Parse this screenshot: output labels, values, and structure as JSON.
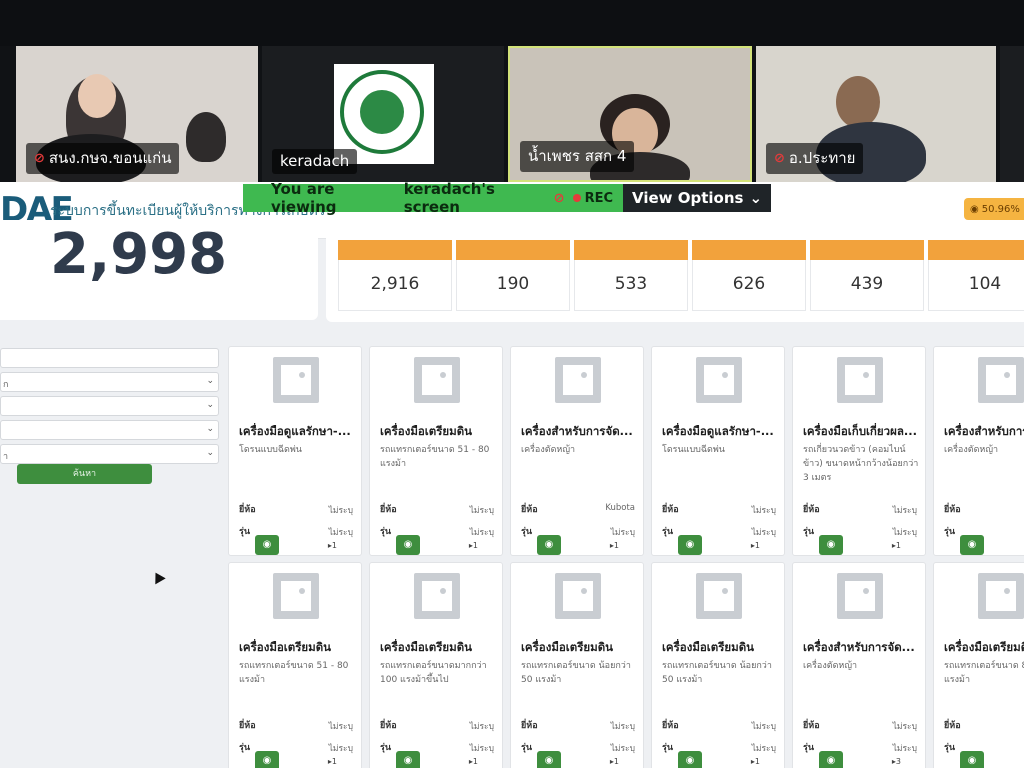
{
  "participants": [
    {
      "name": "สนง.กษจ.ขอนแก่น",
      "muted": true
    },
    {
      "name": "keradach",
      "muted": false
    },
    {
      "name": "น้ำเพชร สสก 4",
      "muted": false
    },
    {
      "name": "อ.ประทาย",
      "muted": true
    }
  ],
  "banner": {
    "viewing": "You are viewing",
    "sharer": "keradach's screen",
    "rec": "REC",
    "view_options": "View Options"
  },
  "site": {
    "logo": "DAE",
    "title": "ระบบการขึ้นทะเบียนผู้ให้บริการทางการเกษตร",
    "badge": "50.96%",
    "total": "2,998",
    "stats": [
      "2,916",
      "190",
      "533",
      "626",
      "439",
      "104"
    ],
    "search_button": "ค้นหา"
  },
  "cards_row1": [
    {
      "name": "เครื่องมือดูแลรักษา-...",
      "desc": "โดรนแบบฉีดพ่น",
      "brand": "ไม่ระบุ",
      "model": "ไม่ระบุ",
      "count": "1"
    },
    {
      "name": "เครื่องมือเตรียมดิน",
      "desc": "รถแทรกเตอร์ขนาด 51 - 80 แรงม้า",
      "brand": "ไม่ระบุ",
      "model": "ไม่ระบุ",
      "count": "1"
    },
    {
      "name": "เครื่องสำหรับการจัด...",
      "desc": "เครื่องตัดหญ้า",
      "brand": "Kubota",
      "model": "ไม่ระบุ",
      "count": "1"
    },
    {
      "name": "เครื่องมือดูแลรักษา-...",
      "desc": "โดรนแบบฉีดพ่น",
      "brand": "ไม่ระบุ",
      "model": "ไม่ระบุ",
      "count": "1"
    },
    {
      "name": "เครื่องมือเก็บเกี่ยวผล...",
      "desc": "รถเกี่ยวนวดข้าว (คอมไบน์ข้าว) ขนาดหน้ากว้างน้อยกว่า 3 เมตร",
      "brand": "ไม่ระบุ",
      "model": "ไม่ระบุ",
      "count": "1"
    },
    {
      "name": "เครื่องสำหรับการ",
      "desc": "เครื่องตัดหญ้า",
      "brand": "",
      "model": "",
      "count": ""
    }
  ],
  "cards_row2": [
    {
      "name": "เครื่องมือเตรียมดิน",
      "desc": "รถแทรกเตอร์ขนาด 51 - 80 แรงม้า",
      "brand": "ไม่ระบุ",
      "model": "ไม่ระบุ",
      "count": "1"
    },
    {
      "name": "เครื่องมือเตรียมดิน",
      "desc": "รถแทรกเตอร์ขนาดมากกว่า 100 แรงม้าขึ้นไป",
      "brand": "ไม่ระบุ",
      "model": "ไม่ระบุ",
      "count": "1"
    },
    {
      "name": "เครื่องมือเตรียมดิน",
      "desc": "รถแทรกเตอร์ขนาด น้อยกว่า 50 แรงม้า",
      "brand": "ไม่ระบุ",
      "model": "ไม่ระบุ",
      "count": "1"
    },
    {
      "name": "เครื่องมือเตรียมดิน",
      "desc": "รถแทรกเตอร์ขนาด น้อยกว่า 50 แรงม้า",
      "brand": "ไม่ระบุ",
      "model": "ไม่ระบุ",
      "count": "1"
    },
    {
      "name": "เครื่องสำหรับการจัด...",
      "desc": "เครื่องตัดหญ้า",
      "brand": "ไม่ระบุ",
      "model": "ไม่ระบุ",
      "count": "3"
    },
    {
      "name": "เครื่องมือเตรียมดิน",
      "desc": "รถแทรกเตอร์ขนาด 8 100 แรงม้า",
      "brand": "",
      "model": "",
      "count": ""
    }
  ],
  "labels": {
    "brand": "ยี่ห้อ",
    "model": "รุ่น"
  }
}
